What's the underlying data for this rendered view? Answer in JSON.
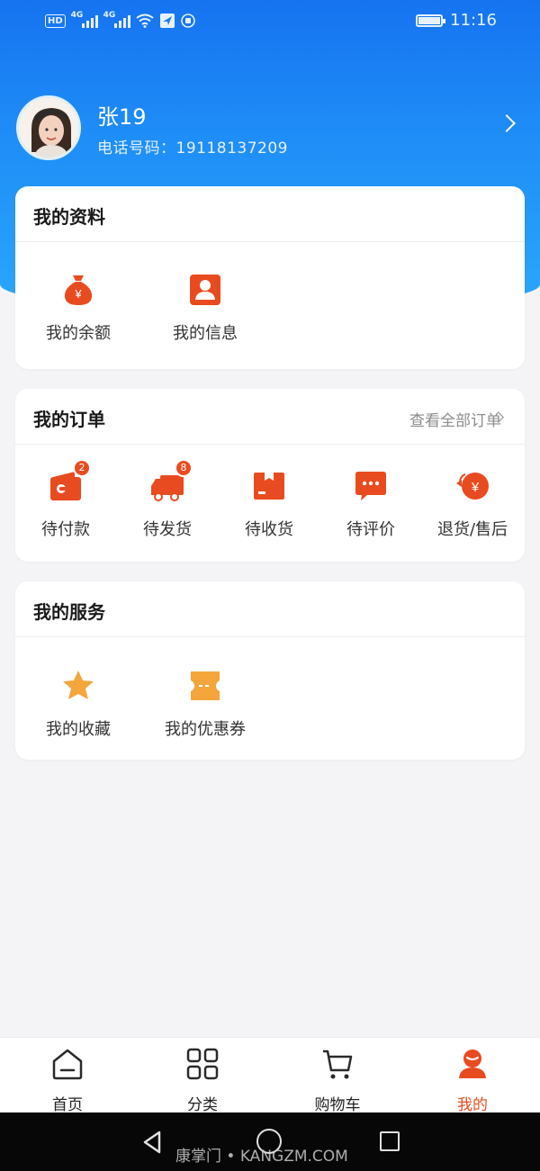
{
  "status_bar": {
    "hd": "HD",
    "sig1": "4G",
    "sig2": "4G",
    "time": "11:16"
  },
  "profile": {
    "name": "张19",
    "phone": "电话号码：19118137209"
  },
  "my_profile": {
    "title": "我的资料",
    "items": [
      {
        "label": "我的余额",
        "icon": "money-bag-icon"
      },
      {
        "label": "我的信息",
        "icon": "user-card-icon"
      }
    ]
  },
  "my_orders": {
    "title": "我的订单",
    "view_all": "查看全部订单",
    "items": [
      {
        "label": "待付款",
        "icon": "wallet-icon",
        "badge": "2"
      },
      {
        "label": "待发货",
        "icon": "truck-icon",
        "badge": "8"
      },
      {
        "label": "待收货",
        "icon": "package-icon"
      },
      {
        "label": "待评价",
        "icon": "comment-icon"
      },
      {
        "label": "退货/售后",
        "icon": "refund-icon"
      }
    ]
  },
  "my_services": {
    "title": "我的服务",
    "items": [
      {
        "label": "我的收藏",
        "icon": "star-icon"
      },
      {
        "label": "我的优惠券",
        "icon": "coupon-icon"
      }
    ]
  },
  "tab_bar": {
    "items": [
      {
        "label": "首页",
        "icon": "home-icon"
      },
      {
        "label": "分类",
        "icon": "category-icon"
      },
      {
        "label": "购物车",
        "icon": "cart-icon"
      },
      {
        "label": "我的",
        "icon": "person-icon",
        "active": true
      }
    ]
  },
  "watermark": "康掌门 • KANGZM.COM",
  "colors": {
    "accent": "#e94b20",
    "header_blue": "#1f8ef7",
    "star": "#f4a63c"
  }
}
